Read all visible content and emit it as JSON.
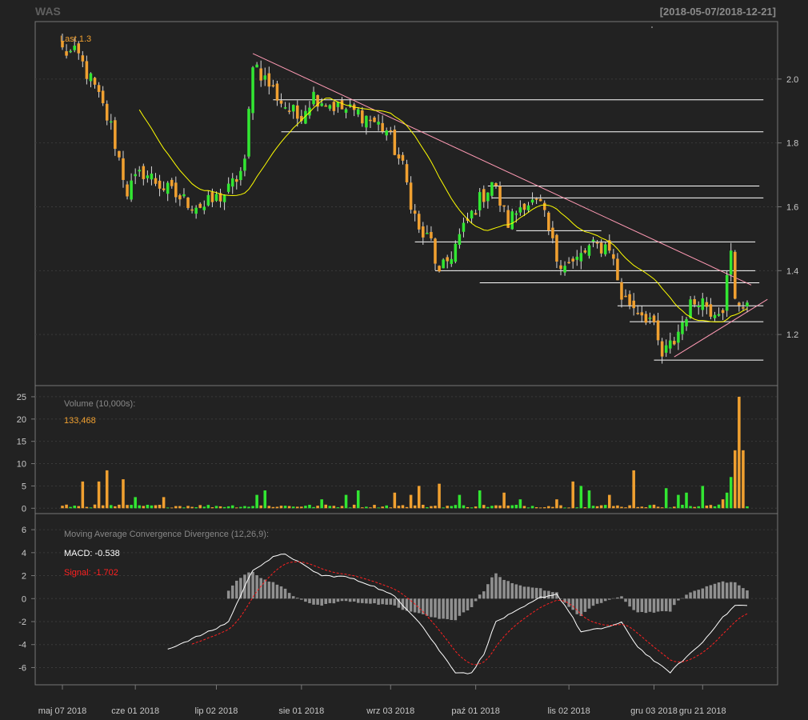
{
  "title": "WAS",
  "date_range": "[2018-05-07/2018-12-21]",
  "colors": {
    "background": "#222222",
    "up": "#32e632",
    "down": "#f0a030",
    "sma": "#ffff00",
    "resistance": "#ff9ab4",
    "level": "#ffffff",
    "signal": "#ff2020",
    "histogram": "#909090",
    "panel_text": "#888888"
  },
  "x_axis": {
    "labels": [
      "maj 07 2018",
      "cze 01 2018",
      "lip 02 2018",
      "sie 01 2018",
      "wrz 03 2018",
      "paź 01 2018",
      "lis 02 2018",
      "gru 03 2018",
      "gru 21 2018"
    ]
  },
  "price_panel": {
    "label": "Last 1.3",
    "y_ticks": [
      "1.2",
      "1.4",
      "1.6",
      "1.8",
      "2.0"
    ]
  },
  "volume_panel": {
    "label": "Volume (10,000s):",
    "value": "133,468",
    "y_ticks": [
      "0",
      "5",
      "10",
      "15",
      "20",
      "25"
    ]
  },
  "macd_panel": {
    "label": "Moving Average Convergence Divergence (12,26,9):",
    "macd_text": "MACD: -0.538",
    "signal_text": "Signal: -1.702",
    "y_ticks": [
      "-6",
      "-4",
      "-2",
      "0",
      "2",
      "4",
      "6"
    ]
  },
  "chart_data": {
    "type": "candlestick",
    "title": "WAS",
    "subtitle": "[2018-05-07/2018-12-21]",
    "last": 1.3,
    "sma_period": 20,
    "price_range": [
      1.04,
      2.18
    ],
    "volume_range": [
      -1.2,
      27.5
    ],
    "macd_range": [
      -7.5,
      7.4
    ],
    "anchors": [
      {
        "i": 0,
        "c": 2.09
      },
      {
        "i": 4,
        "c": 2.07
      },
      {
        "i": 8,
        "c": 1.97
      },
      {
        "i": 12,
        "c": 1.85
      },
      {
        "i": 16,
        "c": 1.65
      },
      {
        "i": 20,
        "c": 1.71
      },
      {
        "i": 26,
        "c": 1.65
      },
      {
        "i": 30,
        "c": 1.62
      },
      {
        "i": 35,
        "c": 1.6
      },
      {
        "i": 41,
        "c": 1.65
      },
      {
        "i": 45,
        "c": 1.73
      },
      {
        "i": 47,
        "c": 2.06
      },
      {
        "i": 50,
        "c": 2.0
      },
      {
        "i": 54,
        "c": 1.93
      },
      {
        "i": 58,
        "c": 1.88
      },
      {
        "i": 62,
        "c": 1.95
      },
      {
        "i": 68,
        "c": 1.91
      },
      {
        "i": 74,
        "c": 1.89
      },
      {
        "i": 80,
        "c": 1.84
      },
      {
        "i": 84,
        "c": 1.72
      },
      {
        "i": 88,
        "c": 1.52
      },
      {
        "i": 91,
        "c": 1.49
      },
      {
        "i": 93,
        "c": 1.38
      },
      {
        "i": 97,
        "c": 1.48
      },
      {
        "i": 102,
        "c": 1.6
      },
      {
        "i": 106,
        "c": 1.68
      },
      {
        "i": 110,
        "c": 1.55
      },
      {
        "i": 114,
        "c": 1.62
      },
      {
        "i": 118,
        "c": 1.6
      },
      {
        "i": 122,
        "c": 1.44
      },
      {
        "i": 126,
        "c": 1.42
      },
      {
        "i": 130,
        "c": 1.47
      },
      {
        "i": 135,
        "c": 1.48
      },
      {
        "i": 138,
        "c": 1.32
      },
      {
        "i": 142,
        "c": 1.28
      },
      {
        "i": 145,
        "c": 1.25
      },
      {
        "i": 148,
        "c": 1.13
      },
      {
        "i": 151,
        "c": 1.18
      },
      {
        "i": 154,
        "c": 1.27
      },
      {
        "i": 157,
        "c": 1.32
      },
      {
        "i": 160,
        "c": 1.28
      },
      {
        "i": 163,
        "c": 1.29
      },
      {
        "i": 165,
        "c": 1.45
      },
      {
        "i": 166,
        "c": 1.3
      }
    ],
    "volume_spikes": [
      {
        "i": 5,
        "v": 6
      },
      {
        "i": 9,
        "v": 6
      },
      {
        "i": 11,
        "v": 8.5
      },
      {
        "i": 15,
        "v": 6.5
      },
      {
        "i": 18,
        "v": 2.5
      },
      {
        "i": 25,
        "v": 2.5
      },
      {
        "i": 48,
        "v": 3
      },
      {
        "i": 50,
        "v": 4
      },
      {
        "i": 64,
        "v": 2
      },
      {
        "i": 70,
        "v": 3
      },
      {
        "i": 73,
        "v": 4
      },
      {
        "i": 82,
        "v": 3.5
      },
      {
        "i": 86,
        "v": 3
      },
      {
        "i": 88,
        "v": 5
      },
      {
        "i": 93,
        "v": 5.5
      },
      {
        "i": 98,
        "v": 3
      },
      {
        "i": 103,
        "v": 4
      },
      {
        "i": 109,
        "v": 3.5
      },
      {
        "i": 113,
        "v": 2
      },
      {
        "i": 122,
        "v": 2
      },
      {
        "i": 126,
        "v": 6
      },
      {
        "i": 128,
        "v": 5
      },
      {
        "i": 130,
        "v": 4
      },
      {
        "i": 135,
        "v": 3
      },
      {
        "i": 141,
        "v": 8.5
      },
      {
        "i": 149,
        "v": 4.5
      },
      {
        "i": 152,
        "v": 3
      },
      {
        "i": 154,
        "v": 3.5
      },
      {
        "i": 158,
        "v": 5
      },
      {
        "i": 163,
        "v": 2
      },
      {
        "i": 164,
        "v": 3.5
      },
      {
        "i": 165,
        "v": 7
      },
      {
        "i": 166,
        "v": 13
      },
      {
        "i": 167,
        "v": 25
      },
      {
        "i": 168,
        "v": 13
      }
    ],
    "macd_anchors": [
      {
        "i": 26,
        "v": -4.4
      },
      {
        "i": 32,
        "v": -3.5
      },
      {
        "i": 38,
        "v": -2.6
      },
      {
        "i": 41,
        "v": -2.0
      },
      {
        "i": 44,
        "v": 0.3
      },
      {
        "i": 47,
        "v": 2.5
      },
      {
        "i": 52,
        "v": 3.6
      },
      {
        "i": 55,
        "v": 3.9
      },
      {
        "i": 60,
        "v": 2.8
      },
      {
        "i": 64,
        "v": 2.0
      },
      {
        "i": 70,
        "v": 1.9
      },
      {
        "i": 76,
        "v": 1.2
      },
      {
        "i": 82,
        "v": 0.2
      },
      {
        "i": 88,
        "v": -2.0
      },
      {
        "i": 93,
        "v": -4.5
      },
      {
        "i": 97,
        "v": -6.4
      },
      {
        "i": 101,
        "v": -6.5
      },
      {
        "i": 104,
        "v": -4.8
      },
      {
        "i": 107,
        "v": -2.0
      },
      {
        "i": 112,
        "v": -1.1
      },
      {
        "i": 118,
        "v": 0.1
      },
      {
        "i": 122,
        "v": 0.4
      },
      {
        "i": 125,
        "v": -1.1
      },
      {
        "i": 128,
        "v": -2.9
      },
      {
        "i": 133,
        "v": -2.6
      },
      {
        "i": 138,
        "v": -2.1
      },
      {
        "i": 142,
        "v": -4.2
      },
      {
        "i": 147,
        "v": -5.7
      },
      {
        "i": 150,
        "v": -6.4
      },
      {
        "i": 153,
        "v": -5.4
      },
      {
        "i": 158,
        "v": -3.8
      },
      {
        "i": 162,
        "v": -2.0
      },
      {
        "i": 166,
        "v": -0.6
      },
      {
        "i": 169,
        "v": -0.6
      }
    ],
    "trendlines": [
      {
        "kind": "resistance",
        "i1": 47,
        "p1": 2.08,
        "i2": 170,
        "p2": 1.355
      },
      {
        "kind": "support",
        "i1": 151,
        "p1": 1.13,
        "i2": 174,
        "p2": 1.31
      }
    ],
    "levels": [
      {
        "p": 1.935,
        "i1": 52,
        "i2": 173
      },
      {
        "p": 1.835,
        "i1": 54,
        "i2": 173
      },
      {
        "p": 1.665,
        "i1": 105,
        "i2": 172
      },
      {
        "p": 1.628,
        "i1": 106,
        "i2": 173
      },
      {
        "p": 1.525,
        "i1": 112,
        "i2": 133
      },
      {
        "p": 1.49,
        "i1": 87,
        "i2": 171
      },
      {
        "p": 1.4,
        "i1": 92,
        "i2": 171
      },
      {
        "p": 1.362,
        "i1": 103,
        "i2": 172
      },
      {
        "p": 1.29,
        "i1": 137,
        "i2": 173
      },
      {
        "p": 1.24,
        "i1": 140,
        "i2": 173
      },
      {
        "p": 1.12,
        "i1": 146,
        "i2": 173
      }
    ]
  }
}
